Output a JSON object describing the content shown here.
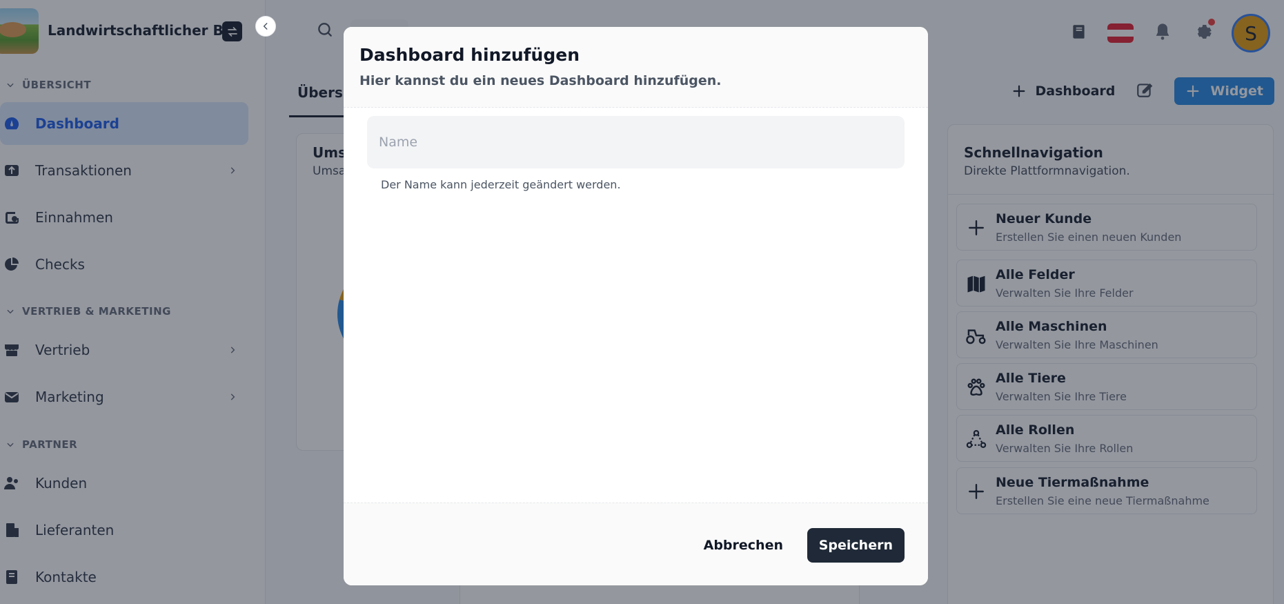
{
  "app": {
    "name": "Landwirtschaftlicher B...",
    "switch_icon": "swap-icon",
    "collapse_icon": "chevron-left-icon"
  },
  "sidebar": {
    "sections": [
      {
        "title": "ÜBERSICHT"
      },
      {
        "title": "VERTRIEB & MARKETING"
      },
      {
        "title": "PARTNER"
      }
    ],
    "items": [
      {
        "label": "Dashboard",
        "icon": "gauge-icon",
        "active": true
      },
      {
        "label": "Transaktionen",
        "icon": "transactions-icon"
      },
      {
        "label": "Einnahmen",
        "icon": "wallet-icon"
      },
      {
        "label": "Checks",
        "icon": "pie-chart-icon"
      },
      {
        "label": "Vertrieb",
        "icon": "store-icon"
      },
      {
        "label": "Marketing",
        "icon": "mail-icon"
      },
      {
        "label": "Kunden",
        "icon": "users-icon"
      },
      {
        "label": "Lieferanten",
        "icon": "building-icon"
      },
      {
        "label": "Kontakte",
        "icon": "address-book-icon"
      }
    ]
  },
  "topbar": {
    "icons": [
      "book-icon",
      "flag-austria-icon",
      "bell-icon",
      "gear-icon"
    ],
    "avatar_initial": "S",
    "colors": {
      "flag_red": "#e3293b",
      "avatar_bg": "#e6a019",
      "notif": "#ef4444"
    }
  },
  "tabs": [
    {
      "label": "Übersicht"
    }
  ],
  "actions": {
    "add_dashboard": "Dashboard",
    "add_widget": "Widget"
  },
  "widget_card": {
    "title": "Umsatz",
    "subtitle": "Umsatz"
  },
  "quicknav": {
    "title": "Schnellnavigation",
    "subtitle": "Direkte Plattformnavigation.",
    "items": [
      {
        "title": "Neuer Kunde",
        "desc": "Erstellen Sie einen neuen Kunden",
        "icon": "plus-icon"
      },
      {
        "title": "Alle Felder",
        "desc": "Verwalten Sie Ihre Felder",
        "icon": "map-icon"
      },
      {
        "title": "Alle Maschinen",
        "desc": "Verwalten Sie Ihre Maschinen",
        "icon": "tractor-icon"
      },
      {
        "title": "Alle Tiere",
        "desc": "Verwalten Sie Ihre Tiere",
        "icon": "paw-icon"
      },
      {
        "title": "Alle Rollen",
        "desc": "Verwalten Sie Ihre Rollen",
        "icon": "roles-icon"
      },
      {
        "title": "Neue Tiermaßnahme",
        "desc": "Erstellen Sie eine neue Tiermaßnahme",
        "icon": "plus-icon"
      }
    ]
  },
  "modal": {
    "title": "Dashboard hinzufügen",
    "description": "Hier kannst du ein neues Dashboard hinzufügen.",
    "name_input": {
      "placeholder": "Name",
      "value": ""
    },
    "hint": "Der Name kann jederzeit geändert werden.",
    "cancel_label": "Abbrechen",
    "save_label": "Speichern"
  }
}
